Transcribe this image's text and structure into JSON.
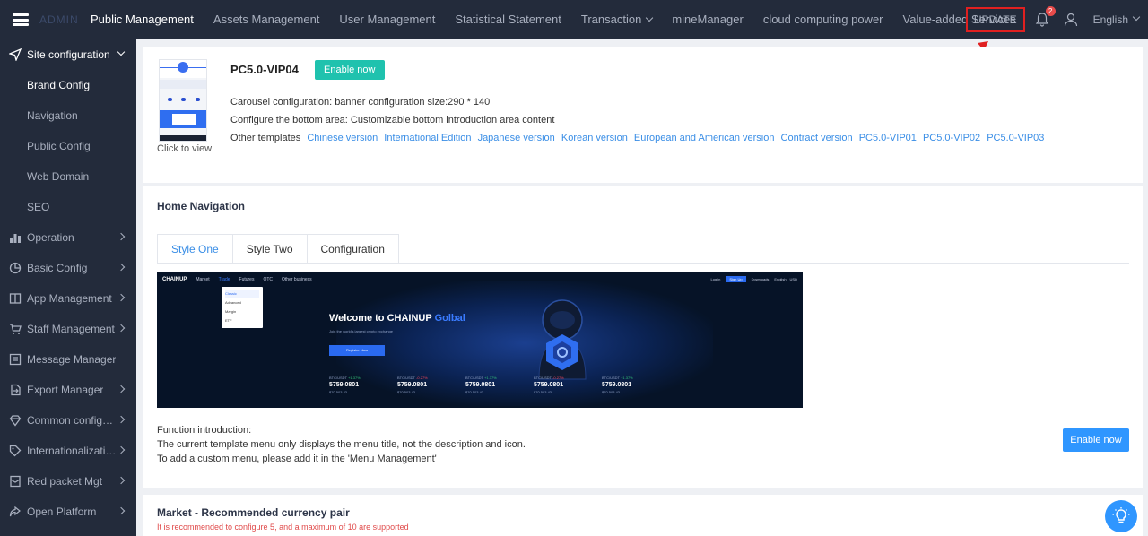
{
  "brand": {
    "logo_text": "ADMIN"
  },
  "topnav": {
    "items": [
      {
        "label": "Public Management",
        "active": true
      },
      {
        "label": "Assets Management"
      },
      {
        "label": "User Management"
      },
      {
        "label": "Statistical Statement"
      },
      {
        "label": "Transaction",
        "dropdown": true
      },
      {
        "label": "mineManager"
      },
      {
        "label": "cloud computing power"
      },
      {
        "label": "Value-added Services"
      }
    ],
    "update_label": "UPDATE",
    "notification_count": "2",
    "language": "English"
  },
  "sidebar": {
    "groups": [
      {
        "label": "Site configuration",
        "icon": "send-icon",
        "open": true
      },
      {
        "label": "Operation",
        "icon": "bar-chart-icon"
      },
      {
        "label": "Basic Config",
        "icon": "pie-chart-icon"
      },
      {
        "label": "App Management",
        "icon": "book-icon"
      },
      {
        "label": "Staff Management",
        "icon": "cart-icon"
      },
      {
        "label": "Message Manager",
        "icon": "message-icon"
      },
      {
        "label": "Export Manager",
        "icon": "export-icon"
      },
      {
        "label": "Common configura...",
        "icon": "diamond-icon"
      },
      {
        "label": "Internationalization...",
        "icon": "tag-icon"
      },
      {
        "label": "Red packet Mgt",
        "icon": "red-packet-icon"
      },
      {
        "label": "Open Platform",
        "icon": "share-icon"
      }
    ],
    "sub_items": [
      {
        "label": "Brand Config",
        "active": true
      },
      {
        "label": "Navigation"
      },
      {
        "label": "Public Config"
      },
      {
        "label": "Web Domain"
      },
      {
        "label": "SEO"
      }
    ]
  },
  "template": {
    "title": "PC5.0-VIP04",
    "enable_label": "Enable now",
    "thumb_caption": "Click to view",
    "carousel_label": "Carousel configuration:",
    "carousel_value": "banner configuration size:290 * 140",
    "bottom_label": "Configure the bottom area:",
    "bottom_value": "Customizable bottom introduction area content",
    "other_label": "Other templates",
    "other_templates": [
      "Chinese version",
      "International Edition",
      "Japanese version",
      "Korean version",
      "European and American version",
      "Contract version",
      "PC5.0-VIP01",
      "PC5.0-VIP02",
      "PC5.0-VIP03"
    ]
  },
  "home_nav": {
    "title": "Home Navigation",
    "tabs": [
      {
        "label": "Style One",
        "active": true
      },
      {
        "label": "Style Two"
      },
      {
        "label": "Configuration"
      }
    ],
    "function_title": "Function introduction:",
    "function_line1": "The current template menu only displays the menu title, not the description and icon.",
    "function_line2": "To add a custom menu, please add it in the 'Menu Management'",
    "enable_label": "Enable now"
  },
  "preview": {
    "logo": "CHAINUP",
    "nav": [
      "Market",
      "Trade",
      "Futures",
      "OTC",
      "Other business"
    ],
    "login": "Log in",
    "signup": "Sign Up",
    "downloads": "Downloads",
    "lang": "English",
    "currency": "USD",
    "dropdown": [
      "Classic",
      "Advanced",
      "Margin",
      "ETF"
    ],
    "welcome_prefix": "Welcome to CHAINUP",
    "welcome_highlight": "Golbal",
    "subtitle": "Join the world's largest crypto exchange",
    "cta": "Register Now",
    "tickers": [
      {
        "pair": "BTC/USDT",
        "change": "+1.37%",
        "price": "5759.0801",
        "sub": "$70.503.43"
      },
      {
        "pair": "BTC/USDT",
        "change": "-0.27%",
        "price": "5759.0801",
        "sub": "$70.503.43"
      },
      {
        "pair": "BTC/USDT",
        "change": "+1.37%",
        "price": "5759.0801",
        "sub": "$70.503.43"
      },
      {
        "pair": "BTC/USDT",
        "change": "-0.27%",
        "price": "5759.0801",
        "sub": "$70.503.43"
      },
      {
        "pair": "BTC/USDT",
        "change": "+1.37%",
        "price": "5759.0801",
        "sub": "$70.503.43"
      }
    ]
  },
  "market": {
    "title": "Market - Recommended currency pair",
    "note": "It is recommended to configure 5, and a maximum of 10 are supported"
  },
  "colors": {
    "accent": "#2f96ff",
    "green": "#1fc2ae",
    "sidebar_bg": "#232b3b",
    "link": "#3a8ee6",
    "warning": "#e02020"
  }
}
